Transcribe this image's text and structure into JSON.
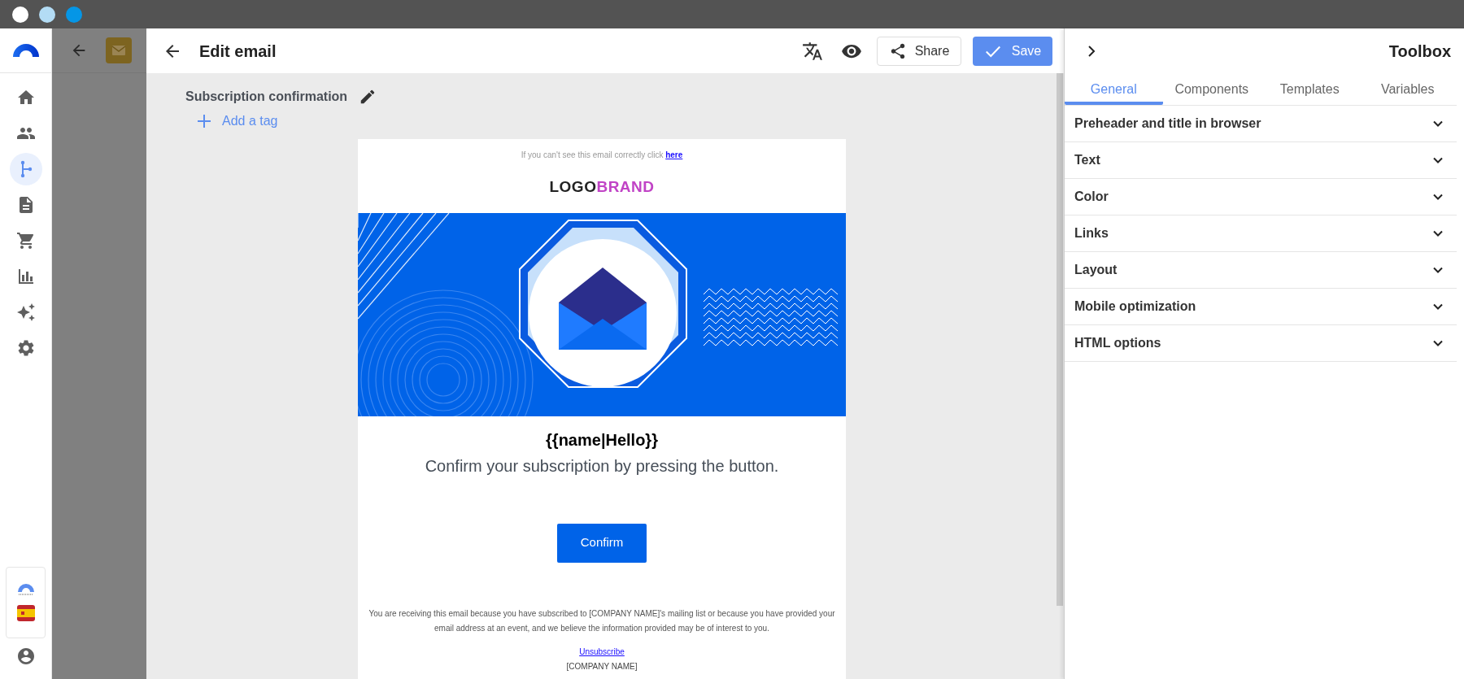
{
  "title_bar": {
    "dots": [
      {
        "color": "#ffffff"
      },
      {
        "color": "#b3dcf5"
      },
      {
        "color": "#0596e6"
      }
    ]
  },
  "sidebar": {
    "items": [
      {
        "kind": "home",
        "selected": false
      },
      {
        "kind": "contacts",
        "selected": false
      },
      {
        "kind": "automation",
        "selected": true
      },
      {
        "kind": "document",
        "selected": false
      },
      {
        "kind": "cart",
        "selected": false
      },
      {
        "kind": "reports",
        "selected": false
      },
      {
        "kind": "ai",
        "selected": false
      },
      {
        "kind": "settings",
        "selected": false
      }
    ]
  },
  "editor": {
    "title": "Edit email",
    "share_label": "Share",
    "save_label": "Save",
    "email_name": "Subscription confirmation",
    "add_tag": "Add a tag"
  },
  "email": {
    "preheader": "If you can't see this email correctly click",
    "preheader_link": "here",
    "logo_dark": "LOGO",
    "logo_accent": "BRAND",
    "greeting": "{{name|Hello}}",
    "message": "Confirm your subscription by pressing the button.",
    "button": "Confirm",
    "footer_text": "You are receiving this email because you have subscribed to [COMPANY NAME]'s mailing list or because you have provided your email address at an event, and we believe the information provided may be of interest to you.",
    "unsubscribe": "Unsubscribe",
    "company": "[COMPANY NAME]"
  },
  "toolbox": {
    "title": "Toolbox",
    "tabs": [
      {
        "label": "General",
        "selected": true
      },
      {
        "label": "Components",
        "selected": false
      },
      {
        "label": "Templates",
        "selected": false
      },
      {
        "label": "Variables",
        "selected": false
      }
    ],
    "sections": [
      {
        "label": "Preheader and title in browser",
        "expanded": false
      },
      {
        "label": "Text",
        "expanded": false
      },
      {
        "label": "Color",
        "expanded": false
      },
      {
        "label": "Links",
        "expanded": false
      },
      {
        "label": "Layout",
        "expanded": false
      },
      {
        "label": "Mobile optimization",
        "expanded": false
      },
      {
        "label": "HTML options",
        "expanded": false
      }
    ]
  }
}
